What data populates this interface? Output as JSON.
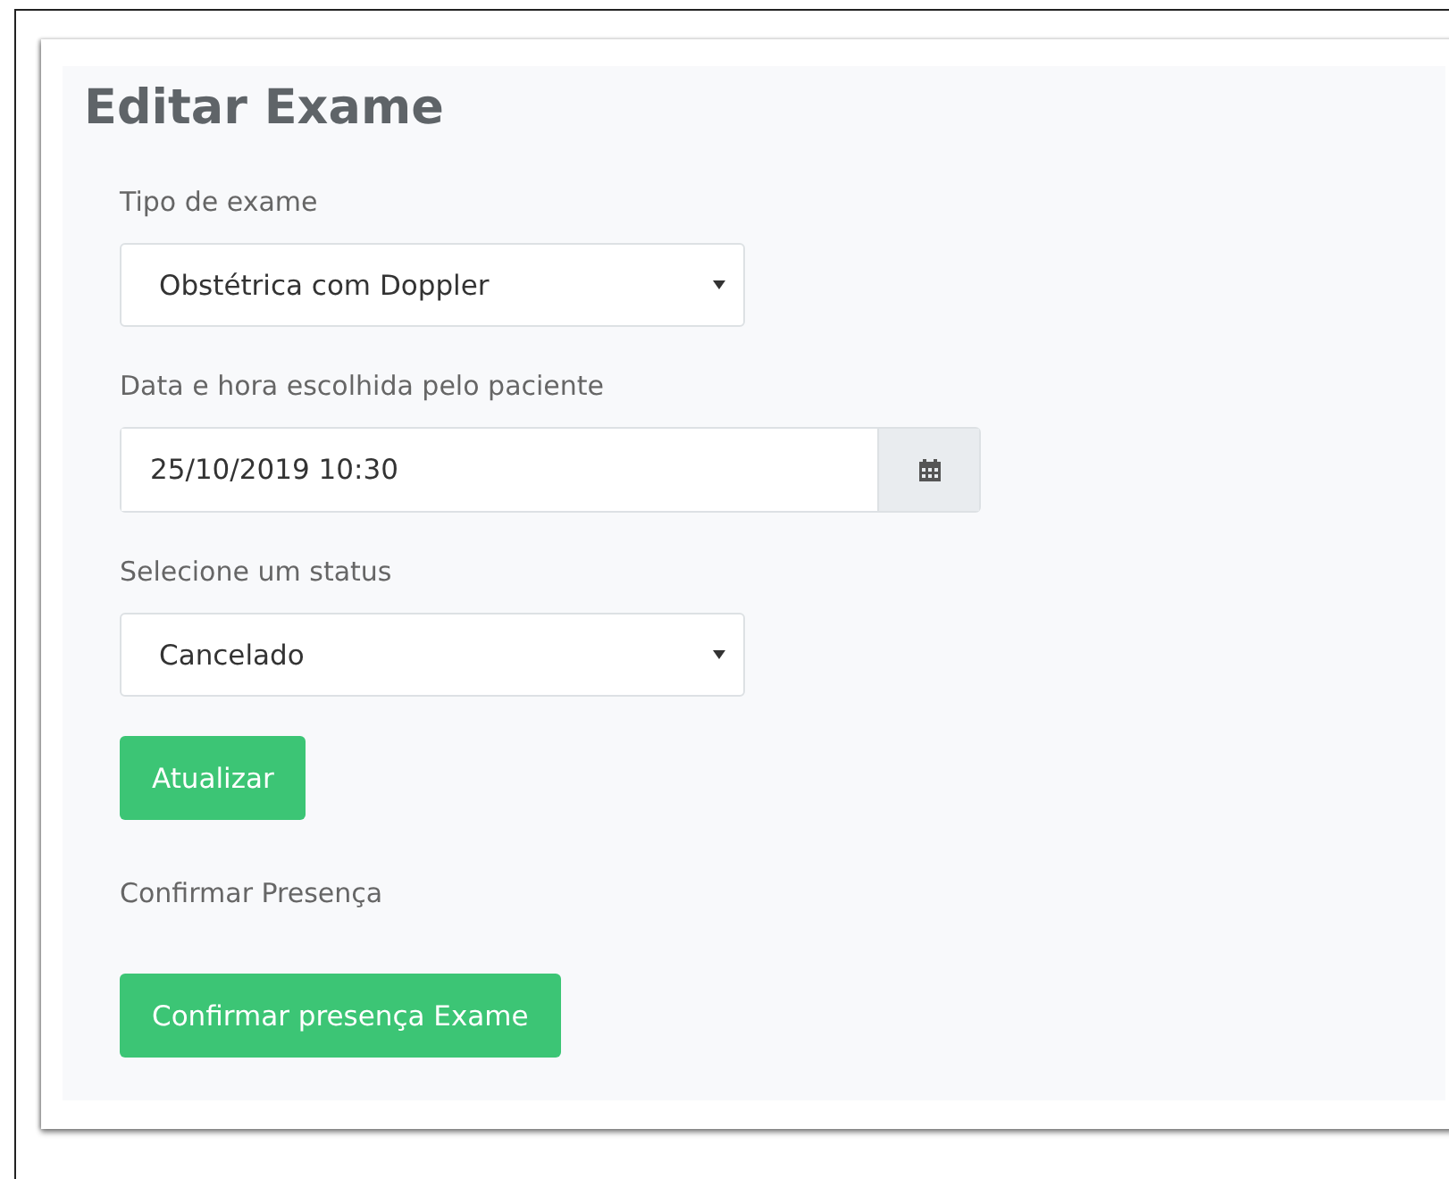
{
  "title": "Editar Exame",
  "fields": [
    {
      "kind": "select",
      "label": "Tipo de exame",
      "value": "Obstétrica com Doppler"
    },
    {
      "kind": "datetime",
      "label": "Data e hora escolhida pelo paciente",
      "value": "25/10/2019 10:30"
    },
    {
      "kind": "select",
      "label": "Selecione um status",
      "value": "Cancelado"
    }
  ],
  "update_button": "Atualizar",
  "presence_label": "Confirmar Presença",
  "presence_button": "Confirmar presença Exame"
}
